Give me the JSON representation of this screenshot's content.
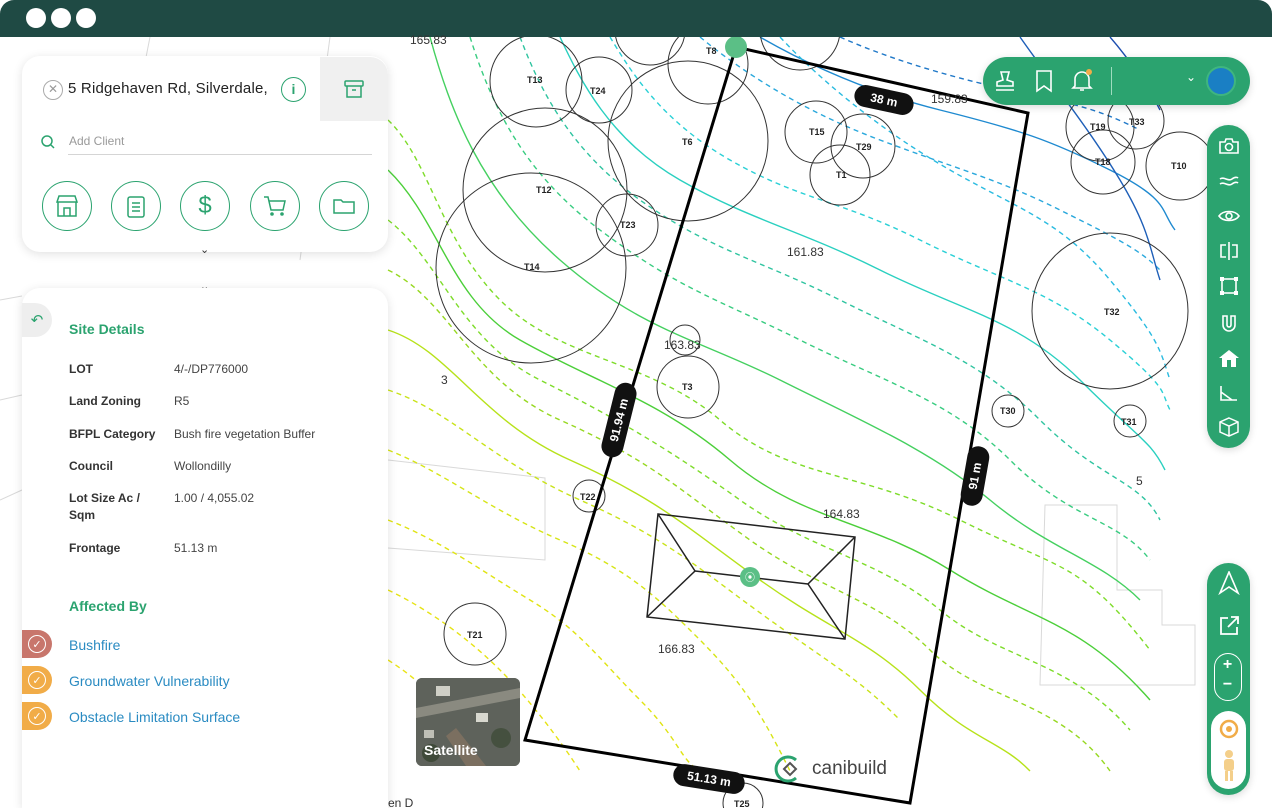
{
  "window": {
    "dots": 3
  },
  "address": {
    "value": "5 Ridgehaven Rd, Silverdale,",
    "client_placeholder": "Add Client"
  },
  "site_details": {
    "title": "Site Details",
    "rows": [
      {
        "label": "LOT",
        "value": "4/-/DP776000"
      },
      {
        "label": "Land Zoning",
        "value": "R5"
      },
      {
        "label": "BFPL Category",
        "value": "Bush fire vegetation Buffer"
      },
      {
        "label": "Council",
        "value": "Wollondilly"
      },
      {
        "label": "Lot Size Ac / Sqm",
        "value": "1.00 / 4,055.02"
      },
      {
        "label": "Frontage",
        "value": "51.13 m"
      }
    ]
  },
  "affected_by": {
    "title": "Affected By",
    "items": [
      {
        "label": "Bushfire",
        "color": "#c8766c"
      },
      {
        "label": "Groundwater Vulnerability",
        "color": "#f1ac48"
      },
      {
        "label": "Obstacle Limitation Surface",
        "color": "#f1ac48"
      }
    ]
  },
  "map": {
    "dimensions": {
      "top": "38 m",
      "left": "91.94 m",
      "right": "91 m",
      "bottom": "51.13 m"
    },
    "elevations": {
      "e1": "165.83",
      "e2": "159.83",
      "e3": "161.83",
      "e4": "163.83",
      "e5": "164.83",
      "e6": "166.83"
    },
    "side_numbers": {
      "n3": "3",
      "n5": "5"
    },
    "trees": {
      "T8": "T8",
      "T13": "T13",
      "T24": "T24",
      "T6": "T6",
      "T12": "T12",
      "T23": "T23",
      "T14": "T14",
      "T15": "T15",
      "T29": "T29",
      "T1": "T1",
      "T19": "T19",
      "T33": "T33",
      "T18": "T18",
      "T10": "T10",
      "T32": "T32",
      "T3": "T3",
      "T22": "T22",
      "T30": "T30",
      "T31": "T31",
      "T21": "T21",
      "T25": "T25"
    },
    "street_partial": "en D"
  },
  "satellite": {
    "label": "Satellite"
  },
  "brand": {
    "name": "canibuild"
  },
  "colors": {
    "accent": "#2ba36f",
    "titlebar": "#1f4a44",
    "link": "#2a8bc2",
    "avatar": "#1a7fc4"
  }
}
